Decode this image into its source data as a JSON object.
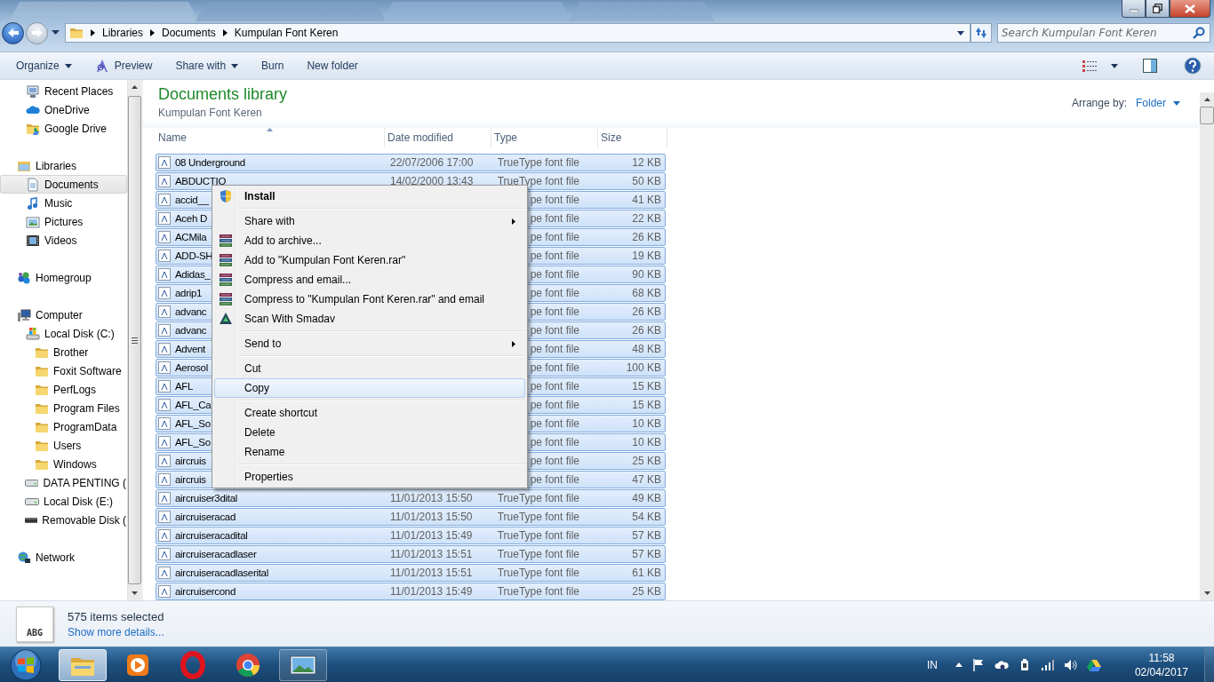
{
  "address_bar": {
    "breadcrumbs": [
      "Libraries",
      "Documents",
      "Kumpulan Font Keren"
    ]
  },
  "search": {
    "placeholder": "Search Kumpulan Font Keren"
  },
  "toolbar": {
    "buttons": [
      {
        "label": "Organize",
        "kind": "plain",
        "dropdown": true
      },
      {
        "label": "Preview",
        "kind": "preview",
        "dropdown": false
      },
      {
        "label": "Share with",
        "kind": "plain",
        "dropdown": true
      },
      {
        "label": "Burn",
        "kind": "plain",
        "dropdown": false
      },
      {
        "label": "New folder",
        "kind": "plain",
        "dropdown": false
      }
    ]
  },
  "sidebar": {
    "favorites": [
      {
        "label": "Recent Places",
        "kind": "recent",
        "selected": false
      },
      {
        "label": "OneDrive",
        "kind": "cloud",
        "selected": false
      },
      {
        "label": "Google Drive",
        "kind": "gdrive",
        "selected": false
      }
    ],
    "tree": [
      {
        "label": "Libraries",
        "kind": "library",
        "selected": false,
        "children": [
          {
            "label": "Documents",
            "kind": "document",
            "selected": true
          },
          {
            "label": "Music",
            "kind": "music",
            "selected": false
          },
          {
            "label": "Pictures",
            "kind": "pictures",
            "selected": false
          },
          {
            "label": "Videos",
            "kind": "videos",
            "selected": false
          }
        ]
      },
      {
        "label": "Homegroup",
        "kind": "homegroup",
        "selected": false
      },
      {
        "label": "Computer",
        "kind": "computer",
        "selected": false,
        "children": [
          {
            "label": "Local Disk (C:)",
            "kind": "disksys",
            "selected": false,
            "children": [
              {
                "label": "Brother",
                "kind": "folder",
                "selected": false
              },
              {
                "label": "Foxit Software",
                "kind": "folder",
                "selected": false
              },
              {
                "label": "PerfLogs",
                "kind": "folder",
                "selected": false
              },
              {
                "label": "Program Files",
                "kind": "folder",
                "selected": false
              },
              {
                "label": "ProgramData",
                "kind": "folder",
                "selected": false
              },
              {
                "label": "Users",
                "kind": "folder",
                "selected": false
              },
              {
                "label": "Windows",
                "kind": "folder",
                "selected": false
              }
            ]
          },
          {
            "label": "DATA PENTING (",
            "kind": "disk",
            "selected": false
          },
          {
            "label": "Local Disk (E:)",
            "kind": "disk",
            "selected": false
          },
          {
            "label": "Removable Disk (",
            "kind": "removable",
            "selected": false
          }
        ]
      },
      {
        "label": "Network",
        "kind": "network",
        "selected": false
      }
    ]
  },
  "library": {
    "title": "Documents library",
    "subtitle": "Kumpulan Font Keren",
    "arrange_label": "Arrange by:",
    "arrange_value": "Folder"
  },
  "table": {
    "columns": [
      {
        "label": "Name",
        "sorted": true
      },
      {
        "label": "Date modified",
        "sorted": false
      },
      {
        "label": "Type",
        "sorted": false
      },
      {
        "label": "Size",
        "sorted": false
      }
    ],
    "rows": [
      {
        "name": "08 Underground",
        "date": "22/07/2006 17:00",
        "type": "TrueType font file",
        "size": "12 KB",
        "selected": true
      },
      {
        "name": "ABDUCTIO",
        "date": "14/02/2000 13:43",
        "type": "TrueType font file",
        "size": "50 KB",
        "selected": true
      },
      {
        "name": "accid__",
        "type": "pe font file",
        "size": "41 KB",
        "selected": true
      },
      {
        "name": "Aceh D",
        "type": "pe font file",
        "size": "22 KB",
        "selected": true
      },
      {
        "name": "ACMila",
        "type": "pe font file",
        "size": "26 KB",
        "selected": true
      },
      {
        "name": "ADD-SH",
        "type": "pe font file",
        "size": "19 KB",
        "selected": true
      },
      {
        "name": "Adidas_",
        "type": "pe font file",
        "size": "90 KB",
        "selected": true
      },
      {
        "name": "adrip1",
        "type": "pe font file",
        "size": "68 KB",
        "selected": true
      },
      {
        "name": "advanc",
        "type": "pe font file",
        "size": "26 KB",
        "selected": true
      },
      {
        "name": "advanc",
        "type": "pe font file",
        "size": "26 KB",
        "selected": true
      },
      {
        "name": "Advent",
        "type": "pe font file",
        "size": "48 KB",
        "selected": true
      },
      {
        "name": "Aerosol",
        "type": "pe font file",
        "size": "100 KB",
        "selected": true
      },
      {
        "name": "AFL",
        "type": "pe font file",
        "size": "15 KB",
        "selected": true
      },
      {
        "name": "AFL_Ca",
        "type": "pe font file",
        "size": "15 KB",
        "selected": true
      },
      {
        "name": "AFL_So",
        "type": "pe font file",
        "size": "10 KB",
        "selected": true
      },
      {
        "name": "AFL_So",
        "type": "pe font file",
        "size": "10 KB",
        "selected": true
      },
      {
        "name": "aircruis",
        "type": "pe font file",
        "size": "25 KB",
        "selected": true
      },
      {
        "name": "aircruis",
        "type": "pe font file",
        "size": "47 KB",
        "selected": true
      },
      {
        "name": "aircruiser3dital",
        "date": "11/01/2013 15:50",
        "type": "TrueType font file",
        "size": "49 KB",
        "selected": true
      },
      {
        "name": "aircruiseracad",
        "date": "11/01/2013 15:50",
        "type": "TrueType font file",
        "size": "54 KB",
        "selected": true
      },
      {
        "name": "aircruiseracadital",
        "date": "11/01/2013 15:49",
        "type": "TrueType font file",
        "size": "57 KB",
        "selected": true
      },
      {
        "name": "aircruiseracadlaser",
        "date": "11/01/2013 15:51",
        "type": "TrueType font file",
        "size": "57 KB",
        "selected": true
      },
      {
        "name": "aircruiseracadlaserital",
        "date": "11/01/2013 15:51",
        "type": "TrueType font file",
        "size": "61 KB",
        "selected": true
      },
      {
        "name": "aircruisercond",
        "date": "11/01/2013 15:49",
        "type": "TrueType font file",
        "size": "25 KB",
        "selected": true
      }
    ]
  },
  "context_menu": {
    "items": [
      {
        "kind": "shield",
        "label": "Install",
        "default": true,
        "submenu": false,
        "selected": false
      },
      {
        "kind": "separator"
      },
      {
        "kind": "plain",
        "label": "Share with",
        "default": false,
        "submenu": true,
        "selected": false
      },
      {
        "kind": "archive",
        "label": "Add to archive...",
        "default": false,
        "submenu": false,
        "selected": false
      },
      {
        "kind": "archive",
        "label": "Add to \"Kumpulan Font Keren.rar\"",
        "default": false,
        "submenu": false,
        "selected": false
      },
      {
        "kind": "archive",
        "label": "Compress and email...",
        "default": false,
        "submenu": false,
        "selected": false
      },
      {
        "kind": "archive",
        "label": "Compress to \"Kumpulan Font Keren.rar\" and email",
        "default": false,
        "submenu": false,
        "selected": false
      },
      {
        "kind": "scan",
        "label": "Scan With Smadav",
        "default": false,
        "submenu": false,
        "selected": false
      },
      {
        "kind": "separator"
      },
      {
        "kind": "plain",
        "label": "Send to",
        "default": false,
        "submenu": true,
        "selected": false
      },
      {
        "kind": "separator"
      },
      {
        "kind": "plain",
        "label": "Cut",
        "default": false,
        "submenu": false,
        "selected": false
      },
      {
        "kind": "plain",
        "label": "Copy",
        "default": false,
        "submenu": false,
        "selected": true
      },
      {
        "kind": "separator"
      },
      {
        "kind": "plain",
        "label": "Create shortcut",
        "default": false,
        "submenu": false,
        "selected": false
      },
      {
        "kind": "plain",
        "label": "Delete",
        "default": false,
        "submenu": false,
        "selected": false
      },
      {
        "kind": "plain",
        "label": "Rename",
        "default": false,
        "submenu": false,
        "selected": false
      },
      {
        "kind": "separator"
      },
      {
        "kind": "plain",
        "label": "Properties",
        "default": false,
        "submenu": false,
        "selected": false
      }
    ]
  },
  "details": {
    "thumbnail_text": "ABG",
    "summary": "575 items selected",
    "link": "Show more details..."
  },
  "taskbar": {
    "apps": [
      {
        "kind": "explorer",
        "selected": true,
        "open": true
      },
      {
        "kind": "media",
        "selected": false,
        "open": false
      },
      {
        "kind": "opera",
        "selected": false,
        "open": false
      },
      {
        "kind": "chrome",
        "selected": false,
        "open": false
      },
      {
        "kind": "photos",
        "selected": false,
        "open": true
      }
    ],
    "language": "IN",
    "time": "11:58",
    "date": "02/04/2017"
  }
}
